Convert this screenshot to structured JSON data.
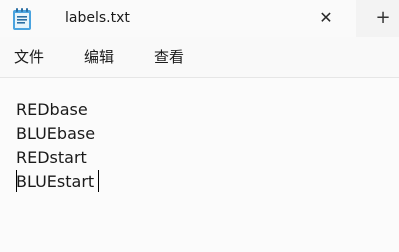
{
  "tab": {
    "icon": "notepad-icon",
    "title": "labels.txt",
    "close_glyph": "✕",
    "new_tab_glyph": "+"
  },
  "menu": {
    "items": [
      {
        "label": "文件"
      },
      {
        "label": "编辑"
      },
      {
        "label": "查看"
      }
    ]
  },
  "editor": {
    "lines": [
      "REDbase",
      "BLUEbase",
      "REDstart",
      "BLUEstart"
    ]
  }
}
